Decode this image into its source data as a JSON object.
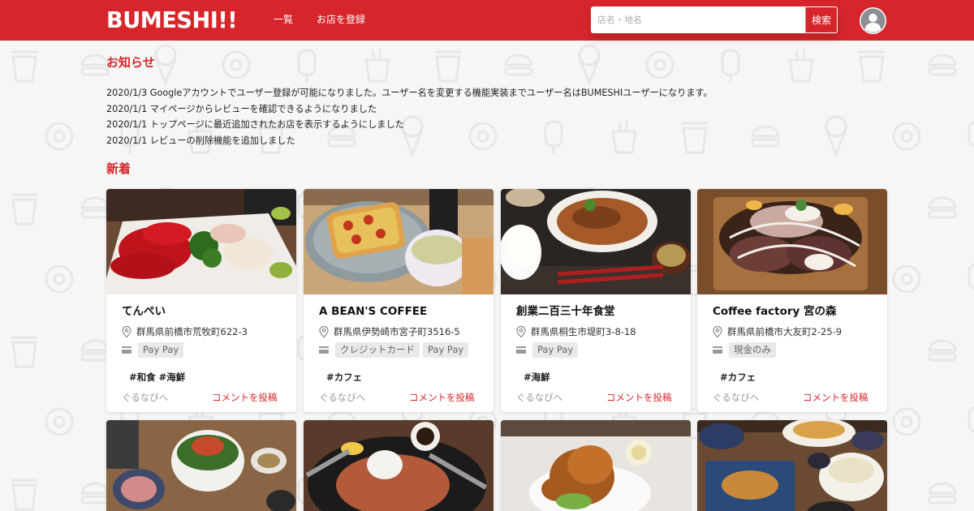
{
  "header": {
    "logo": "BUMESHI!!",
    "nav": {
      "list_label": "一覧",
      "register_label": "お店を登録"
    },
    "search": {
      "placeholder": "店名・地名",
      "button_label": "検索"
    }
  },
  "news": {
    "title": "お知らせ",
    "items": [
      "2020/1/3 Googleアカウントでユーザー登録が可能になりました。ユーザー名を変更する機能実装までユーザー名はBUMESHIユーザーになります。",
      "2020/1/1 マイページからレビューを確認できるようになりました",
      "2020/1/1 トップページに最近追加されたお店を表示するようにしました",
      "2020/1/1 レビューの削除機能を追加しました"
    ]
  },
  "new_section": {
    "title": "新着",
    "cards": [
      {
        "name": "てんぺい",
        "address": "群馬県前橋市荒牧町622-3",
        "payments": [
          "Pay Pay"
        ],
        "tags": "#和食 #海鮮",
        "gurunavi": "ぐるなびへ",
        "comment": "コメントを投稿",
        "photo": "sashimi-photo"
      },
      {
        "name": "A BEAN'S COFFEE",
        "address": "群馬県伊勢崎市宮子町3516-5",
        "payments": [
          "クレジットカード",
          "Pay Pay"
        ],
        "tags": "#カフェ",
        "gurunavi": "ぐるなびへ",
        "comment": "コメントを投稿",
        "photo": "pizza-toast-photo"
      },
      {
        "name": "創業二百三十年食堂",
        "address": "群馬県桐生市堤町3-8-18",
        "payments": [
          "Pay Pay"
        ],
        "tags": "#海鮮",
        "gurunavi": "ぐるなびへ",
        "comment": "コメントを投稿",
        "photo": "fish-set-meal-photo"
      },
      {
        "name": "Coffee factory 宮の森",
        "address": "群馬県前橋市大友町2-25-9",
        "payments": [
          "現金のみ"
        ],
        "tags": "#カフェ",
        "gurunavi": "ぐるなびへ",
        "comment": "コメントを投稿",
        "photo": "crepe-dessert-photo"
      }
    ],
    "second_row_photos": [
      "donburi-photo",
      "steak-photo",
      "fried-chicken-photo",
      "katsu-set-photo"
    ]
  },
  "colors": {
    "brand_red": "#d7262b",
    "page_bg": "#f6f6f6",
    "tag_bg": "#e9e9e9"
  },
  "icons": {
    "location": "map-pin-icon",
    "payment": "credit-card-icon",
    "user": "user-avatar-icon"
  }
}
